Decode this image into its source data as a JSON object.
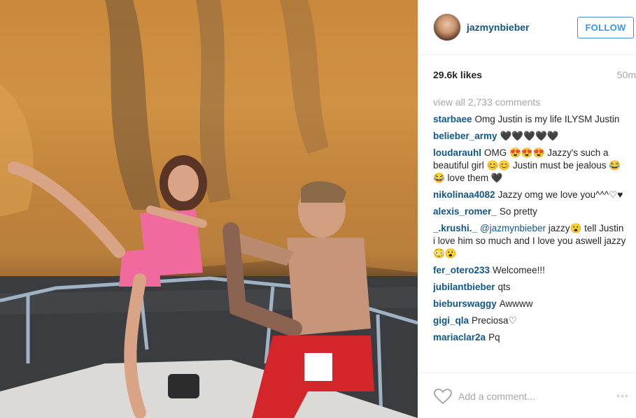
{
  "post": {
    "username": "jazmynbieber",
    "follow_label": "FOLLOW",
    "likes": "29.6k likes",
    "time": "50m",
    "view_all": "view all 2,733 comments",
    "add_comment_placeholder": "Add a comment...",
    "more_label": "◦◦◦",
    "photo_alt": "photo"
  },
  "comments": [
    {
      "user": "starbaee",
      "text": "Omg Justin is my life ILYSM Justin"
    },
    {
      "user": "belieber_army",
      "text": "🖤🖤🖤🖤🖤"
    },
    {
      "user": "loudarauhl",
      "text": "OMG 😍😍😍 Jazzy's such a beautiful girl 😊😊 Justin must be jealous 😂😂 love them 🖤"
    },
    {
      "user": "nikolinaa4082",
      "text": "Jazzy omg we love you^^^♡♥"
    },
    {
      "user": "alexis_romer_",
      "text": "So pretty"
    },
    {
      "user": "_.krushi._",
      "mention": "@jazmynbieber",
      "text": " jazzy😮 tell Justin i love him so much and I love you aswell jazzy😳😮"
    },
    {
      "user": "fer_otero233",
      "text": "Welcomee!!!"
    },
    {
      "user": "jubilantbieber",
      "text": "qts"
    },
    {
      "user": "bieburswaggy",
      "text": "Awwww"
    },
    {
      "user": "gigi_qla",
      "text": "Preciosa♡"
    },
    {
      "user": "mariaclar2a",
      "text": "Pq"
    }
  ]
}
